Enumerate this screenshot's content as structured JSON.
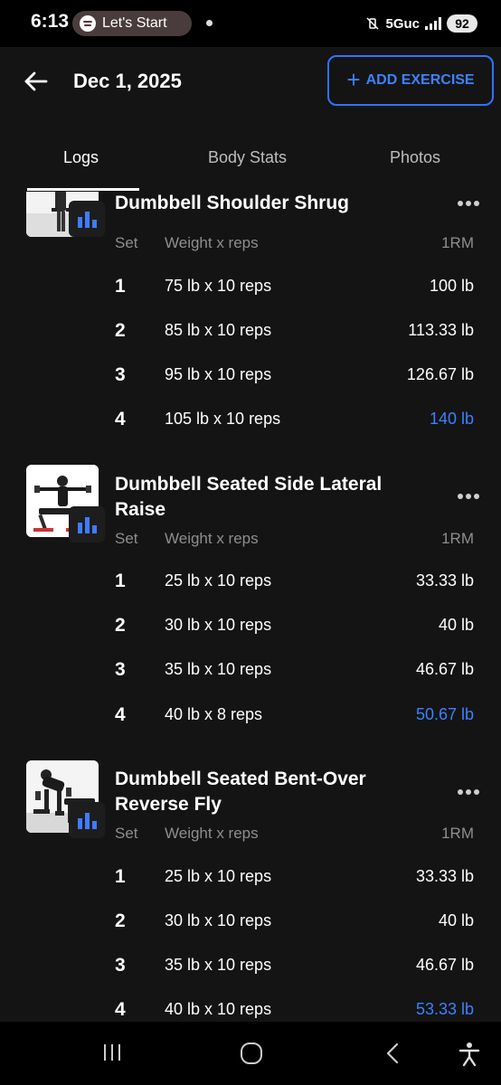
{
  "status_bar": {
    "time": "6:13",
    "media_pill": "Let's Start",
    "network": "5Guc",
    "battery": "92"
  },
  "header": {
    "date": "Dec 1, 2025",
    "add_button": "ADD EXERCISE"
  },
  "tabs": [
    {
      "label": "Logs",
      "active": true
    },
    {
      "label": "Body Stats",
      "active": false
    },
    {
      "label": "Photos",
      "active": false
    }
  ],
  "columns": {
    "set": "Set",
    "weight_reps": "Weight x reps",
    "one_rm": "1RM"
  },
  "exercises": [
    {
      "name": "Dumbbell Shoulder Shrug",
      "sets": [
        {
          "set": "1",
          "weight_reps": "75 lb x 10 reps",
          "one_rm": "100 lb",
          "best": false
        },
        {
          "set": "2",
          "weight_reps": "85 lb x 10 reps",
          "one_rm": "113.33 lb",
          "best": false
        },
        {
          "set": "3",
          "weight_reps": "95 lb x 10 reps",
          "one_rm": "126.67 lb",
          "best": false
        },
        {
          "set": "4",
          "weight_reps": "105 lb x 10 reps",
          "one_rm": "140 lb",
          "best": true
        }
      ]
    },
    {
      "name": "Dumbbell Seated Side Lateral Raise",
      "sets": [
        {
          "set": "1",
          "weight_reps": "25 lb x 10 reps",
          "one_rm": "33.33 lb",
          "best": false
        },
        {
          "set": "2",
          "weight_reps": "30 lb x 10 reps",
          "one_rm": "40 lb",
          "best": false
        },
        {
          "set": "3",
          "weight_reps": "35 lb x 10 reps",
          "one_rm": "46.67 lb",
          "best": false
        },
        {
          "set": "4",
          "weight_reps": "40 lb x 8 reps",
          "one_rm": "50.67 lb",
          "best": true
        }
      ]
    },
    {
      "name": "Dumbbell Seated Bent-Over Reverse Fly",
      "sets": [
        {
          "set": "1",
          "weight_reps": "25 lb x 10 reps",
          "one_rm": "33.33 lb",
          "best": false
        },
        {
          "set": "2",
          "weight_reps": "30 lb x 10 reps",
          "one_rm": "40 lb",
          "best": false
        },
        {
          "set": "3",
          "weight_reps": "35 lb x 10 reps",
          "one_rm": "46.67 lb",
          "best": false
        },
        {
          "set": "4",
          "weight_reps": "40 lb x 10 reps",
          "one_rm": "53.33 lb",
          "best": true
        }
      ]
    }
  ],
  "colors": {
    "accent": "#3b82ff",
    "background": "#141414"
  }
}
